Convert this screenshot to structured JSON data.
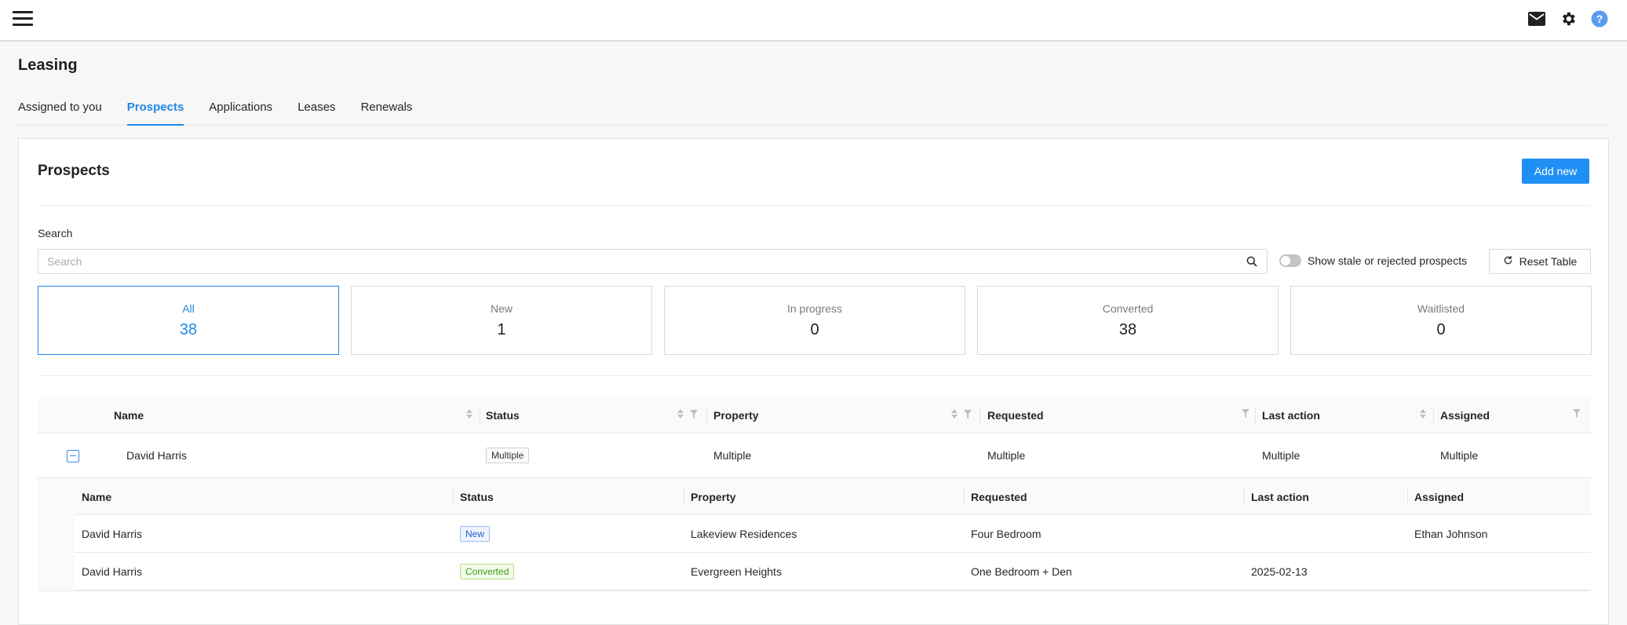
{
  "header": {
    "icons": [
      "menu-icon",
      "mail-icon",
      "gear-icon",
      "help-icon"
    ]
  },
  "page": {
    "title": "Leasing"
  },
  "tabs": [
    {
      "label": "Assigned to you",
      "active": false
    },
    {
      "label": "Prospects",
      "active": true
    },
    {
      "label": "Applications",
      "active": false
    },
    {
      "label": "Leases",
      "active": false
    },
    {
      "label": "Renewals",
      "active": false
    }
  ],
  "panel": {
    "title": "Prospects",
    "add_label": "Add new",
    "search_label": "Search",
    "search_placeholder": "Search",
    "toggle_label": "Show stale or rejected prospects",
    "reset_label": "Reset Table"
  },
  "stats": [
    {
      "label": "All",
      "value": "38",
      "active": true
    },
    {
      "label": "New",
      "value": "1",
      "active": false
    },
    {
      "label": "In progress",
      "value": "0",
      "active": false
    },
    {
      "label": "Converted",
      "value": "38",
      "active": false
    },
    {
      "label": "Waitlisted",
      "value": "0",
      "active": false
    }
  ],
  "table": {
    "columns": [
      "Name",
      "Status",
      "Property",
      "Requested",
      "Last action",
      "Assigned"
    ],
    "group_row": {
      "name": "David Harris",
      "status": "Multiple",
      "property": "Multiple",
      "requested": "Multiple",
      "last_action": "Multiple",
      "assigned": "Multiple"
    },
    "sub_columns": [
      "Name",
      "Status",
      "Property",
      "Requested",
      "Last action",
      "Assigned"
    ],
    "sub_rows": [
      {
        "name": "David Harris",
        "status": "New",
        "property": "Lakeview Residences",
        "requested": "Four Bedroom",
        "last_action": "",
        "assigned": "Ethan Johnson"
      },
      {
        "name": "David Harris",
        "status": "Converted",
        "property": "Evergreen Heights",
        "requested": "One Bedroom + Den",
        "last_action": "2025-02-13",
        "assigned": ""
      }
    ]
  },
  "colors": {
    "accent": "#1f87e5",
    "button": "#1f8ff5"
  }
}
